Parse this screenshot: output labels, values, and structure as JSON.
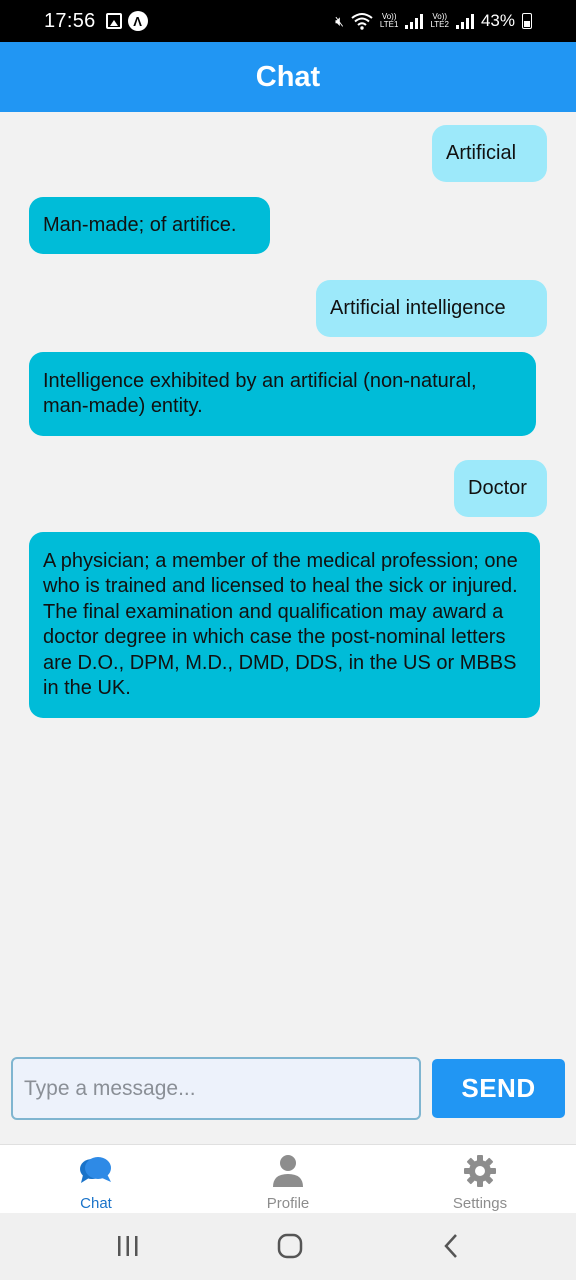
{
  "status_bar": {
    "time": "17:56",
    "battery": "43%",
    "sim1": "LTE1",
    "sim2": "LTE2",
    "volte": "Vo))"
  },
  "header": {
    "title": "Chat"
  },
  "messages": [
    {
      "role": "user",
      "text": "Artificial"
    },
    {
      "role": "bot",
      "text": "Man-made; of artifice."
    },
    {
      "role": "user",
      "text": "Artificial intelligence"
    },
    {
      "role": "bot",
      "text": "Intelligence exhibited by an artificial (non-natural, man-made) entity."
    },
    {
      "role": "user",
      "text": "Doctor"
    },
    {
      "role": "bot",
      "text": "A physician; a member of the medical profession; one who is trained and licensed to heal the sick or injured. The final examination and qualification may award a doctor degree in which case the post-nominal letters are D.O., DPM, M.D., DMD, DDS, in the US or MBBS in the UK."
    }
  ],
  "composer": {
    "placeholder": "Type a message...",
    "value": "",
    "send_label": "SEND"
  },
  "tabs": [
    {
      "label": "Chat",
      "icon": "chat-bubbles-icon",
      "active": true
    },
    {
      "label": "Profile",
      "icon": "person-icon",
      "active": false
    },
    {
      "label": "Settings",
      "icon": "gear-icon",
      "active": false
    }
  ],
  "colors": {
    "primary": "#2196f3",
    "user_bubble": "#9de9fa",
    "bot_bubble": "#00bcd8",
    "active_tab": "#1a73c9",
    "inactive_tab": "#8d8d8d"
  }
}
